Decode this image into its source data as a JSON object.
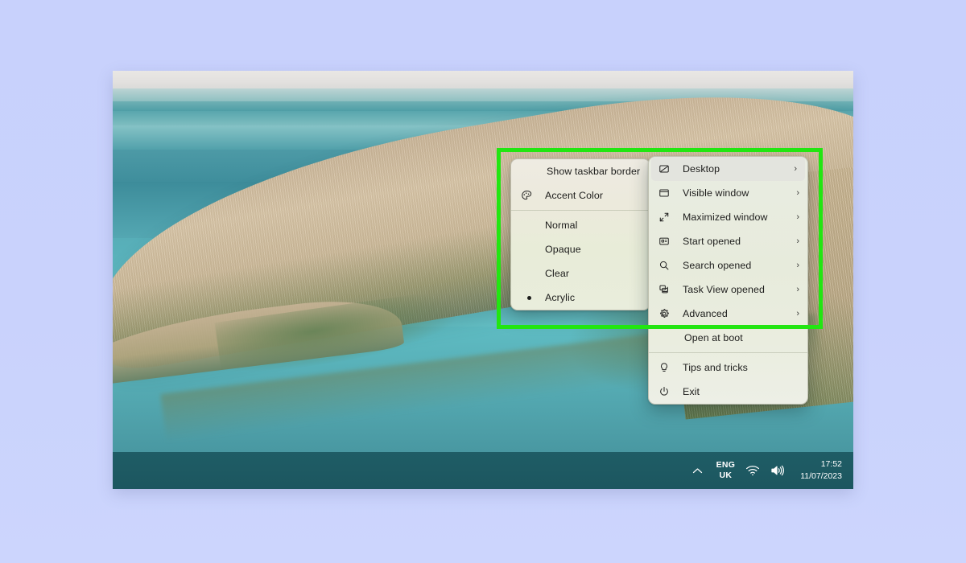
{
  "desktop": {
    "wallpaper_description": "turquoise lake with dry reed bank",
    "colors": {
      "page_background": "#c9d2fc",
      "taskbar": "#1d5a63",
      "water": "#57aeb8",
      "reeds": "#cdbb9c",
      "highlight_box": "#22e611",
      "menu_background": "#e9ece2"
    }
  },
  "taskbar": {
    "tray": {
      "chevron_icon": "chevron-up-icon",
      "language": {
        "line1": "ENG",
        "line2": "UK"
      },
      "wifi_icon": "wifi-icon",
      "volume_icon": "speaker-icon",
      "clock": {
        "time": "17:52",
        "date": "11/07/2023"
      }
    }
  },
  "menu_left": {
    "items": [
      {
        "label": "Show taskbar border",
        "icon": "none",
        "type": "plain"
      },
      {
        "label": "Accent Color",
        "icon": "palette-icon",
        "type": "icon"
      },
      {
        "label": "Normal",
        "icon": "none",
        "type": "radio",
        "selected": false
      },
      {
        "label": "Opaque",
        "icon": "none",
        "type": "radio",
        "selected": false
      },
      {
        "label": "Clear",
        "icon": "none",
        "type": "radio",
        "selected": false
      },
      {
        "label": "Acrylic",
        "icon": "none",
        "type": "radio",
        "selected": true
      }
    ]
  },
  "menu_right": {
    "items": [
      {
        "label": "Desktop",
        "icon": "desktop-icon",
        "chevron": "›",
        "highlighted": true
      },
      {
        "label": "Visible window",
        "icon": "window-icon",
        "chevron": "›",
        "highlighted": false
      },
      {
        "label": "Maximized window",
        "icon": "maximize-icon",
        "chevron": "›",
        "highlighted": false
      },
      {
        "label": "Start opened",
        "icon": "start-icon",
        "chevron": "›",
        "highlighted": false
      },
      {
        "label": "Search opened",
        "icon": "search-icon",
        "chevron": "›",
        "highlighted": false
      },
      {
        "label": "Task View opened",
        "icon": "taskview-icon",
        "chevron": "›",
        "highlighted": false
      },
      {
        "label": "Advanced",
        "icon": "gear-icon",
        "chevron": "›",
        "highlighted": false
      },
      {
        "label": "Open at boot",
        "icon": "none",
        "chevron": "",
        "highlighted": false
      },
      {
        "label": "Tips and tricks",
        "icon": "bulb-icon",
        "chevron": "",
        "highlighted": false
      },
      {
        "label": "Exit",
        "icon": "power-icon",
        "chevron": "",
        "highlighted": false
      }
    ]
  }
}
